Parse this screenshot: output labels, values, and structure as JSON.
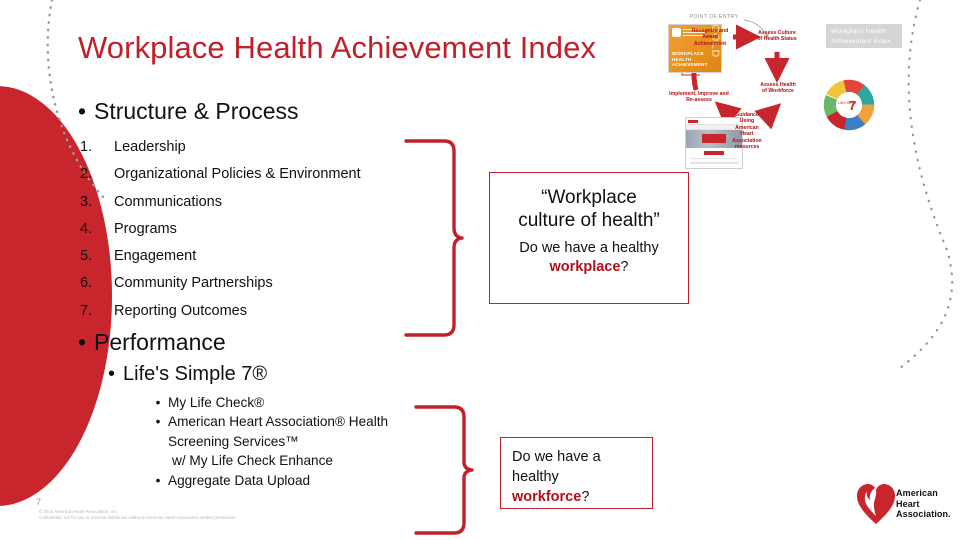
{
  "slide": {
    "title": "Workplace Health Achievement Index",
    "page_number": "7",
    "copyright_line1": "© 2016 American Heart Association, Inc.",
    "copyright_line2": "confidential: not for use or external distribution without American Heart Association written permission"
  },
  "structure": {
    "heading": "Structure & Process",
    "bullet_glyph": "•",
    "items": [
      {
        "num": "1.",
        "label": "Leadership"
      },
      {
        "num": "2.",
        "label": "Organizational Policies & Environment"
      },
      {
        "num": "3.",
        "label": "Communications"
      },
      {
        "num": "4.",
        "label": "Programs"
      },
      {
        "num": "5.",
        "label": "Engagement"
      },
      {
        "num": "6.",
        "label": "Community Partnerships"
      },
      {
        "num": "7.",
        "label": "Reporting Outcomes"
      }
    ]
  },
  "performance": {
    "heading": "Performance",
    "sub_heading": "Life's Simple 7®",
    "bullet_glyph": "•",
    "items": [
      {
        "glyph": "•",
        "label": "My Life Check®"
      },
      {
        "glyph": "•",
        "label": "American Heart Association® Health Screening Services™"
      },
      {
        "glyph": "",
        "label": "w/ My Life Check Enhance"
      },
      {
        "glyph": "•",
        "label": "Aggregate Data Upload"
      }
    ]
  },
  "callouts": {
    "workplace": {
      "quote_line1": "“Workplace",
      "quote_line2": "culture of health”",
      "question_prefix": "Do we have a healthy ",
      "question_emphasis": "workplace",
      "question_suffix": "?"
    },
    "workforce": {
      "line1": "Do we have a",
      "line2": "healthy",
      "emphasis": "workforce",
      "suffix": "?"
    }
  },
  "diagram": {
    "gray_label": "Workplace Health Achievement Index",
    "point_of_entry": "POINT OF ENTRY",
    "badge": {
      "word": "GOLD",
      "caption": "WORKPLACE HEALTH ACHIEVEMENT"
    },
    "wheel_center_small": "Life's Simple",
    "wheel_center_big": "7",
    "nodes": [
      {
        "key": "recognize",
        "text_bold": "Recognize",
        "text_rest": " and Award Achievement"
      },
      {
        "key": "assess_culture",
        "text_bold": "Assess",
        "text_rest": " Culture of Health Status"
      },
      {
        "key": "assess_health",
        "text_bold": "Assess",
        "text_rest": " Health of Workforce"
      },
      {
        "key": "guidance",
        "text_bold": "Guidance",
        "text_rest": " Using American Heart Association resources"
      },
      {
        "key": "implement",
        "text_bold": "Implement",
        "text_rest": ", Improve and Re-assess"
      }
    ]
  },
  "logo": {
    "line1": "American",
    "line2": "Heart",
    "line3": "Association."
  },
  "colors": {
    "brand_red": "#C0202A",
    "deep_red": "#B01116",
    "ellipse_red": "#C8252C",
    "gold": "#E8911F",
    "gray_label": "#D5D5D5"
  }
}
